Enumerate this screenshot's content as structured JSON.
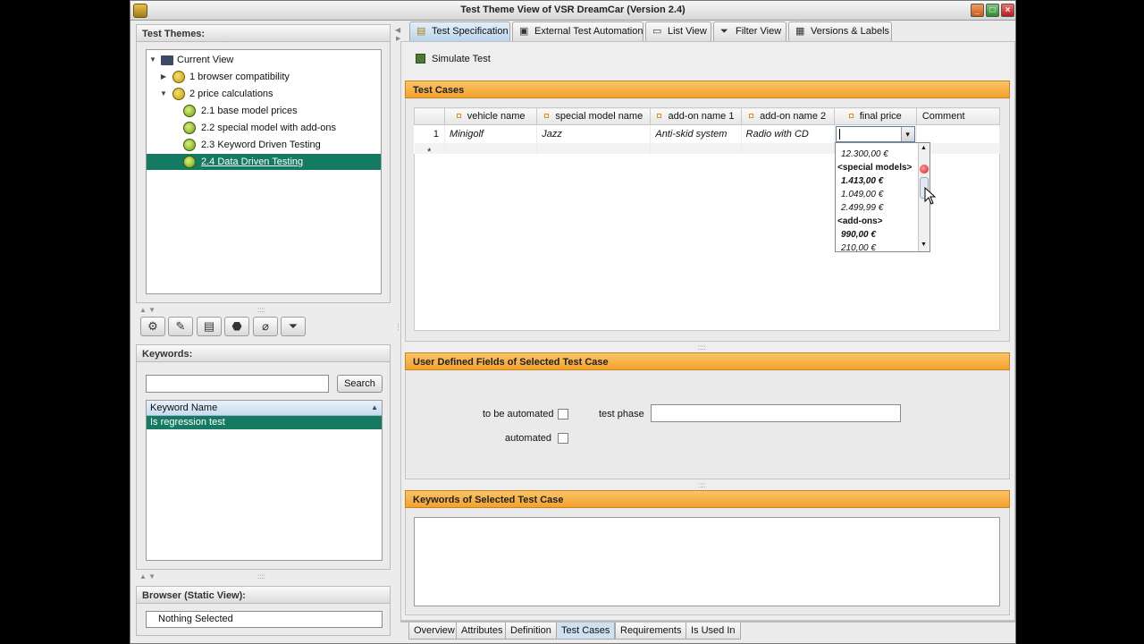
{
  "window": {
    "title": "Test Theme View of VSR DreamCar (Version 2.4)"
  },
  "test_themes": {
    "header": "Test Themes:",
    "tree": [
      {
        "label": "Current View",
        "icon": "folder-icon"
      },
      {
        "label": "1 browser compatibility",
        "icon": "test-theme-icon"
      },
      {
        "label": "2 price calculations",
        "icon": "test-theme-icon"
      },
      {
        "label": "2.1 base model prices",
        "icon": "test-theme-icon"
      },
      {
        "label": "2.2 special model with add-ons",
        "icon": "test-theme-icon"
      },
      {
        "label": "2.3 Keyword Driven Testing",
        "icon": "test-theme-icon"
      },
      {
        "label": "2.4 Data Driven Testing",
        "icon": "test-theme-icon",
        "selected": true
      }
    ]
  },
  "toolbar_icons": [
    "gear-icon",
    "wrench-icon",
    "document-icon",
    "stop-icon",
    "paperclip-icon",
    "filter-icon"
  ],
  "keywords": {
    "header": "Keywords:",
    "search_value": "",
    "search_button": "Search",
    "column_header": "Keyword Name",
    "sort_indicator": "▲",
    "rows": [
      "Is regression test"
    ]
  },
  "browser": {
    "header": "Browser (Static View):",
    "value": "Nothing Selected"
  },
  "tabs": [
    {
      "label": "Test Specification",
      "icon": "test-spec-icon",
      "active": true
    },
    {
      "label": "External Test Automation",
      "icon": "automation-icon"
    },
    {
      "label": "List View",
      "icon": "list-view-icon"
    },
    {
      "label": "Filter View",
      "icon": "filter-icon"
    },
    {
      "label": "Versions & Labels",
      "icon": "versions-icon"
    }
  ],
  "simulate_label": "Simulate Test",
  "test_cases": {
    "header": "Test Cases",
    "columns": [
      "",
      "vehicle name",
      "special model name",
      "add-on name 1",
      "add-on name 2",
      "final price",
      "Comment"
    ],
    "rows": [
      {
        "num": "1",
        "vehicle_name": "Minigolf",
        "special_model_name": "Jazz",
        "addon1": "Anti-skid system",
        "addon2": "Radio with CD",
        "final_price": "",
        "comment": ""
      }
    ],
    "new_row_marker": "*",
    "dropdown_arrow": "▾",
    "dropdown_items": [
      {
        "text": "12.300,00 €",
        "kind": "price"
      },
      {
        "text": "<special models>",
        "kind": "group"
      },
      {
        "text": "1.413,00 €",
        "kind": "price-bold"
      },
      {
        "text": "1.049,00 €",
        "kind": "price"
      },
      {
        "text": "2.499,99 €",
        "kind": "price"
      },
      {
        "text": "<add-ons>",
        "kind": "group"
      },
      {
        "text": "990,00 €",
        "kind": "price-bold"
      },
      {
        "text": "210,00 €",
        "kind": "price"
      }
    ],
    "scroll_up": "▲",
    "scroll_down": "▼"
  },
  "user_defined": {
    "header": "User Defined Fields of Selected Test Case",
    "to_be_automated_label": "to be automated",
    "to_be_automated_checked": false,
    "test_phase_label": "test phase",
    "test_phase_value": "",
    "automated_label": "automated",
    "automated_checked": false
  },
  "keywords_of_case": {
    "header": "Keywords of Selected Test Case"
  },
  "bottom_tabs": [
    {
      "label": "Overview"
    },
    {
      "label": "Attributes"
    },
    {
      "label": "Definition"
    },
    {
      "label": "Test Cases",
      "active": true
    },
    {
      "label": "Requirements"
    },
    {
      "label": "Is Used In"
    }
  ],
  "colors": {
    "accent_orange": "#f3a12b",
    "selection_green": "#157a62",
    "tab_blue": "#b9d4ec"
  }
}
